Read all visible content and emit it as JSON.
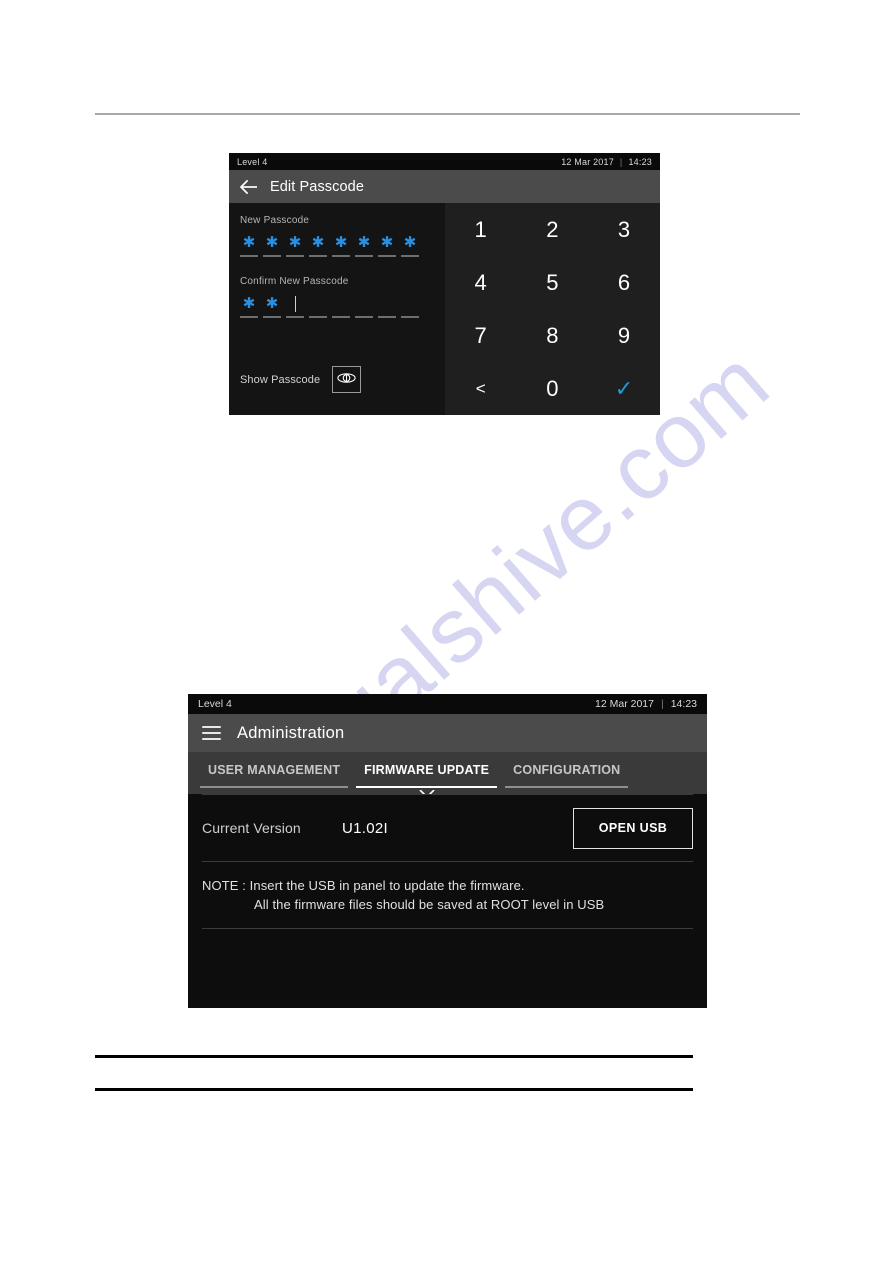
{
  "watermark": {
    "text": "manualshive.com"
  },
  "panel_passcode": {
    "statusbar": {
      "level": "Level 4",
      "date": "12 Mar 2017",
      "separator": "|",
      "time": "14:23"
    },
    "titlebar": {
      "back_icon": "back-arrow-icon",
      "title": "Edit Passcode"
    },
    "new_passcode": {
      "label": "New Passcode",
      "slot_count": 8,
      "filled": 8,
      "mask_char": "✱",
      "caret_index": -1
    },
    "confirm_passcode": {
      "label": "Confirm New Passcode",
      "slot_count": 8,
      "filled": 2,
      "mask_char": "✱",
      "caret_index": 2
    },
    "show_passcode": {
      "label": "Show Passcode",
      "icon": "eye-icon"
    },
    "keypad": {
      "keys": [
        {
          "label": "1",
          "name": "key-1",
          "kind": "digit"
        },
        {
          "label": "2",
          "name": "key-2",
          "kind": "digit"
        },
        {
          "label": "3",
          "name": "key-3",
          "kind": "digit"
        },
        {
          "label": "4",
          "name": "key-4",
          "kind": "digit"
        },
        {
          "label": "5",
          "name": "key-5",
          "kind": "digit"
        },
        {
          "label": "6",
          "name": "key-6",
          "kind": "digit"
        },
        {
          "label": "7",
          "name": "key-7",
          "kind": "digit"
        },
        {
          "label": "8",
          "name": "key-8",
          "kind": "digit"
        },
        {
          "label": "9",
          "name": "key-9",
          "kind": "digit"
        },
        {
          "label": "<",
          "name": "key-backspace",
          "kind": "back"
        },
        {
          "label": "0",
          "name": "key-0",
          "kind": "digit"
        },
        {
          "label": "✓",
          "name": "key-confirm",
          "kind": "ok"
        }
      ]
    },
    "colors": {
      "accent_blue": "#2b8fe0",
      "confirm_blue": "#1f9bdb",
      "titlebar_gray": "#4b4b4b",
      "panel_black": "#111111"
    }
  },
  "panel_admin": {
    "statusbar": {
      "level": "Level 4",
      "date": "12 Mar 2017",
      "separator": "|",
      "time": "14:23"
    },
    "titlebar": {
      "menu_icon": "hamburger-menu-icon",
      "title": "Administration"
    },
    "tabs": [
      {
        "label": "USER MANAGEMENT",
        "name": "tab-user-management",
        "active": false
      },
      {
        "label": "FIRMWARE UPDATE",
        "name": "tab-firmware-update",
        "active": true
      },
      {
        "label": "CONFIGURATION",
        "name": "tab-configuration",
        "active": false
      }
    ],
    "firmware": {
      "version_label": "Current Version",
      "version_value": "U1.02I",
      "open_usb_label": "OPEN USB"
    },
    "note": {
      "line1": "NOTE : Insert the USB in panel to update the firmware.",
      "line2": "All the firmware files should be saved at ROOT level in USB"
    },
    "colors": {
      "titlebar_gray": "#4b4b4b",
      "tabbar_gray": "#3a3a3a",
      "panel_black": "#0d0d0d"
    }
  }
}
